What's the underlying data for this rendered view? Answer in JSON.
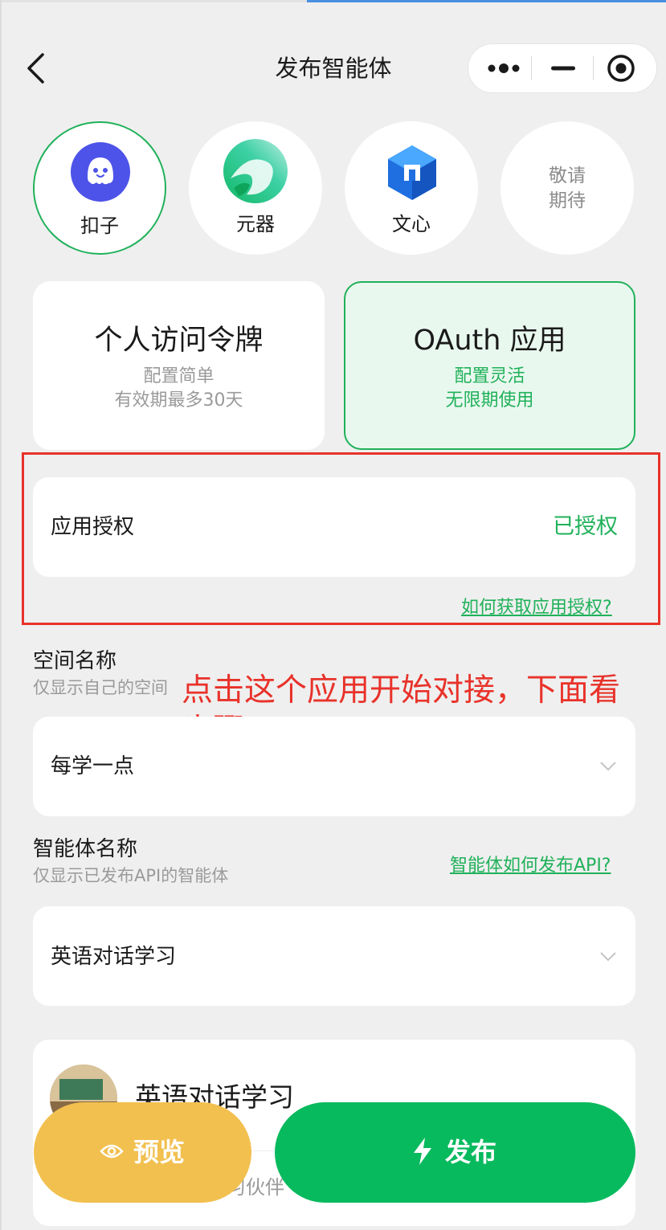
{
  "header": {
    "title": "发布智能体"
  },
  "platforms": [
    {
      "label": "扣子",
      "icon": "coze-ghost-icon",
      "selected": true
    },
    {
      "label": "元器",
      "icon": "yuanqi-logo-icon",
      "selected": false
    },
    {
      "label": "文心",
      "icon": "wenxin-cube-icon",
      "selected": false
    },
    {
      "label": "敬请\n期待",
      "line1": "敬请",
      "line2": "期待",
      "placeholder": true
    }
  ],
  "auth_types": [
    {
      "title": "个人访问令牌",
      "line1": "配置简单",
      "line2": "有效期最多30天",
      "selected": false
    },
    {
      "title": "OAuth 应用",
      "line1": "配置灵活",
      "line2": "无限期使用",
      "selected": true
    }
  ],
  "app_auth": {
    "label": "应用授权",
    "status": "已授权",
    "help_link": "如何获取应用授权?"
  },
  "annotation": {
    "line1": "点击这个应用开始对接，下面看",
    "line2": "步骤"
  },
  "space": {
    "title": "空间名称",
    "subtitle": "仅显示自己的空间",
    "subtitle_visible": "仅显示自己的空间",
    "value": "每学一点"
  },
  "agent": {
    "title": "智能体名称",
    "subtitle": "仅显示已发布API的智能体",
    "help_link": "智能体如何发布API?",
    "value": "英语对话学习"
  },
  "agent_card": {
    "name": "英语对话学习",
    "desc_visible": "习伙伴"
  },
  "actions": {
    "preview": "预览",
    "publish": "发布"
  },
  "colors": {
    "accent": "#20b15a",
    "publish": "#08ba5e",
    "preview": "#f2c04f",
    "annotation": "#e8322a"
  }
}
